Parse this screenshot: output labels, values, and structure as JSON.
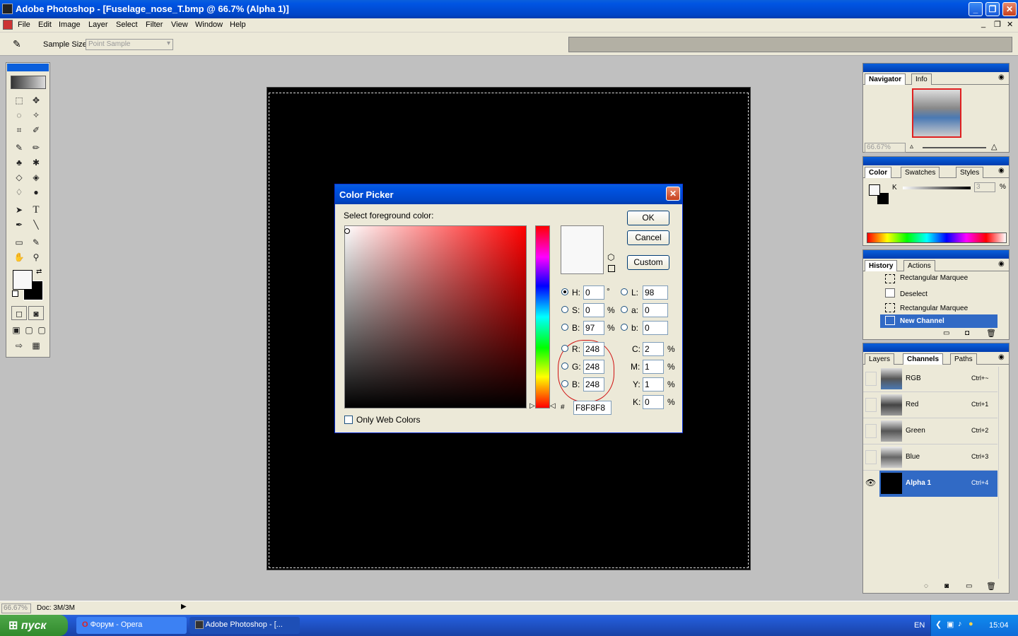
{
  "window": {
    "title": "Adobe Photoshop - [Fuselage_nose_T.bmp @ 66.7% (Alpha 1)]"
  },
  "menu": [
    "File",
    "Edit",
    "Image",
    "Layer",
    "Select",
    "Filter",
    "View",
    "Window",
    "Help"
  ],
  "options": {
    "sample_size_label": "Sample Size:",
    "sample_size_value": "Point Sample"
  },
  "dialog": {
    "title": "Color Picker",
    "prompt": "Select foreground color:",
    "ok": "OK",
    "cancel": "Cancel",
    "custom": "Custom",
    "hsb": {
      "h_label": "H:",
      "h": "0",
      "h_unit": "°",
      "s_label": "S:",
      "s": "0",
      "s_unit": "%",
      "b_label": "B:",
      "b": "97",
      "b_unit": "%"
    },
    "lab": {
      "l_label": "L:",
      "l": "98",
      "a_label": "a:",
      "a": "0",
      "b_label": "b:",
      "b": "0"
    },
    "rgb": {
      "r_label": "R:",
      "r": "248",
      "g_label": "G:",
      "g": "248",
      "b_label": "B:",
      "b": "248"
    },
    "cmyk": {
      "c_label": "C:",
      "c": "2",
      "m_label": "M:",
      "m": "1",
      "y_label": "Y:",
      "y": "1",
      "k_label": "K:",
      "k": "0",
      "unit": "%"
    },
    "hex_label": "#",
    "hex": "F8F8F8",
    "only_web": "Only Web Colors",
    "swatch_color": "#f8f8f8",
    "hue_color": "#ff0000"
  },
  "navigator": {
    "tabs": [
      "Navigator",
      "Info"
    ],
    "zoom": "66.67%"
  },
  "color_panel": {
    "tabs": [
      "Color",
      "Swatches",
      "Styles"
    ],
    "k_label": "K",
    "k_value": "3",
    "unit": "%"
  },
  "history": {
    "tabs": [
      "History",
      "Actions"
    ],
    "items": [
      "Rectangular Marquee",
      "Deselect",
      "Rectangular Marquee",
      "New Channel"
    ]
  },
  "channels": {
    "tabs": [
      "Layers",
      "Channels",
      "Paths"
    ],
    "items": [
      {
        "name": "RGB",
        "key": "Ctrl+~"
      },
      {
        "name": "Red",
        "key": "Ctrl+1"
      },
      {
        "name": "Green",
        "key": "Ctrl+2"
      },
      {
        "name": "Blue",
        "key": "Ctrl+3"
      },
      {
        "name": "Alpha 1",
        "key": "Ctrl+4"
      }
    ]
  },
  "status": {
    "zoom": "66.67%",
    "doc": "Doc: 3M/3M"
  },
  "taskbar": {
    "start": "пуск",
    "tasks": [
      "Форум - Opera",
      "Adobe Photoshop - [..."
    ],
    "lang": "EN",
    "time": "15:04"
  }
}
